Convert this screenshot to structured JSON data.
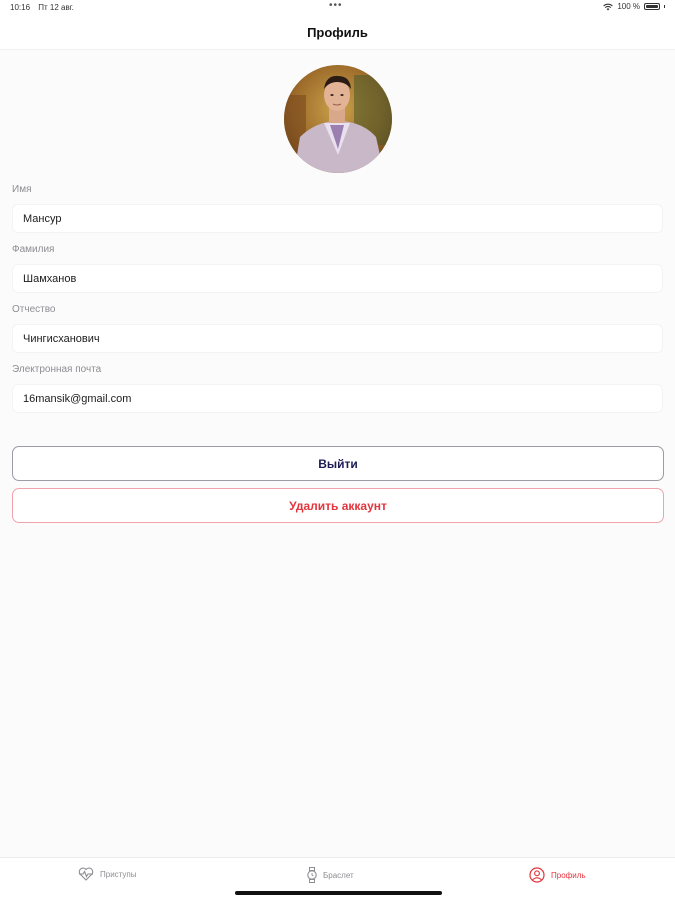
{
  "status_bar": {
    "time": "10:16",
    "date": "Пт 12 авг.",
    "center_dots": "•••",
    "battery_text": "100 %"
  },
  "header": {
    "title": "Профиль"
  },
  "profile": {
    "avatar_description_icon": "user-photo",
    "fields": [
      {
        "label": "Имя",
        "value": "Мансур"
      },
      {
        "label": "Фамилия",
        "value": "Шамханов"
      },
      {
        "label": "Отчество",
        "value": "Чингисханович"
      },
      {
        "label": "Электронная почта",
        "value": "16mansik@gmail.com"
      }
    ]
  },
  "actions": {
    "logout_label": "Выйти",
    "delete_label": "Удалить аккаунт"
  },
  "tab_bar": {
    "tabs": [
      {
        "label": "Приступы",
        "icon": "heartbeat-icon",
        "active": false
      },
      {
        "label": "Браслет",
        "icon": "watch-icon",
        "active": false
      },
      {
        "label": "Профиль",
        "icon": "profile-icon",
        "active": true
      }
    ]
  },
  "colors": {
    "accent": "#e3353d",
    "logout_text": "#1c1b55",
    "background": "#fbfbfc"
  }
}
